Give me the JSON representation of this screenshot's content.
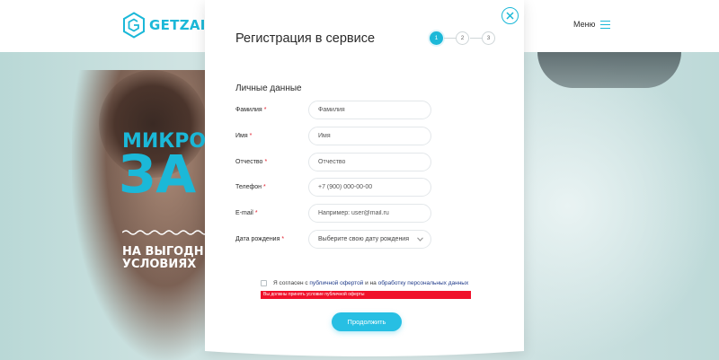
{
  "brand": {
    "name": "GETZAIM",
    "color": "#1bb8d8",
    "logo_icon": "hexagon-g-logo"
  },
  "header": {
    "menu_label": "Меню",
    "menu_icon": "burger-icon"
  },
  "hero": {
    "line1": "МИКРО",
    "line2": "ЗА",
    "line3": "НА ВЫГОДН УСЛОВИЯХ",
    "wave_icon": "wave-icon"
  },
  "modal": {
    "title": "Регистрация в сервисе",
    "close_icon": "close-icon",
    "steps": [
      {
        "label": "1",
        "active": true
      },
      {
        "label": "2",
        "active": false
      },
      {
        "label": "3",
        "active": false
      }
    ],
    "section_title": "Личные данные",
    "fields": [
      {
        "label": "Фамилия",
        "required": "*",
        "placeholder": "Фамилия"
      },
      {
        "label": "Имя",
        "required": "*",
        "placeholder": "Имя"
      },
      {
        "label": "Отчество",
        "required": "*",
        "placeholder": "Отчество"
      },
      {
        "label": "Телефон",
        "required": "*",
        "placeholder": "+7 (900) 000-00-00"
      },
      {
        "label": "E-mail",
        "required": "*",
        "placeholder": "Например: user@mail.ru"
      }
    ],
    "birth_date": {
      "label": "Дата рождения",
      "required": "*",
      "value": "Выберите свою дату рождения"
    },
    "consent": {
      "text_before": "Я согласен с ",
      "link1": "публичной офертой",
      "text_middle": " и на ",
      "link2": "обработку персональных данных"
    },
    "error_message": "Вы должны принять условие публичной оферты",
    "submit_label": "Продолжить",
    "accent_color": "#27bfe3",
    "error_color": "#f0112a"
  }
}
